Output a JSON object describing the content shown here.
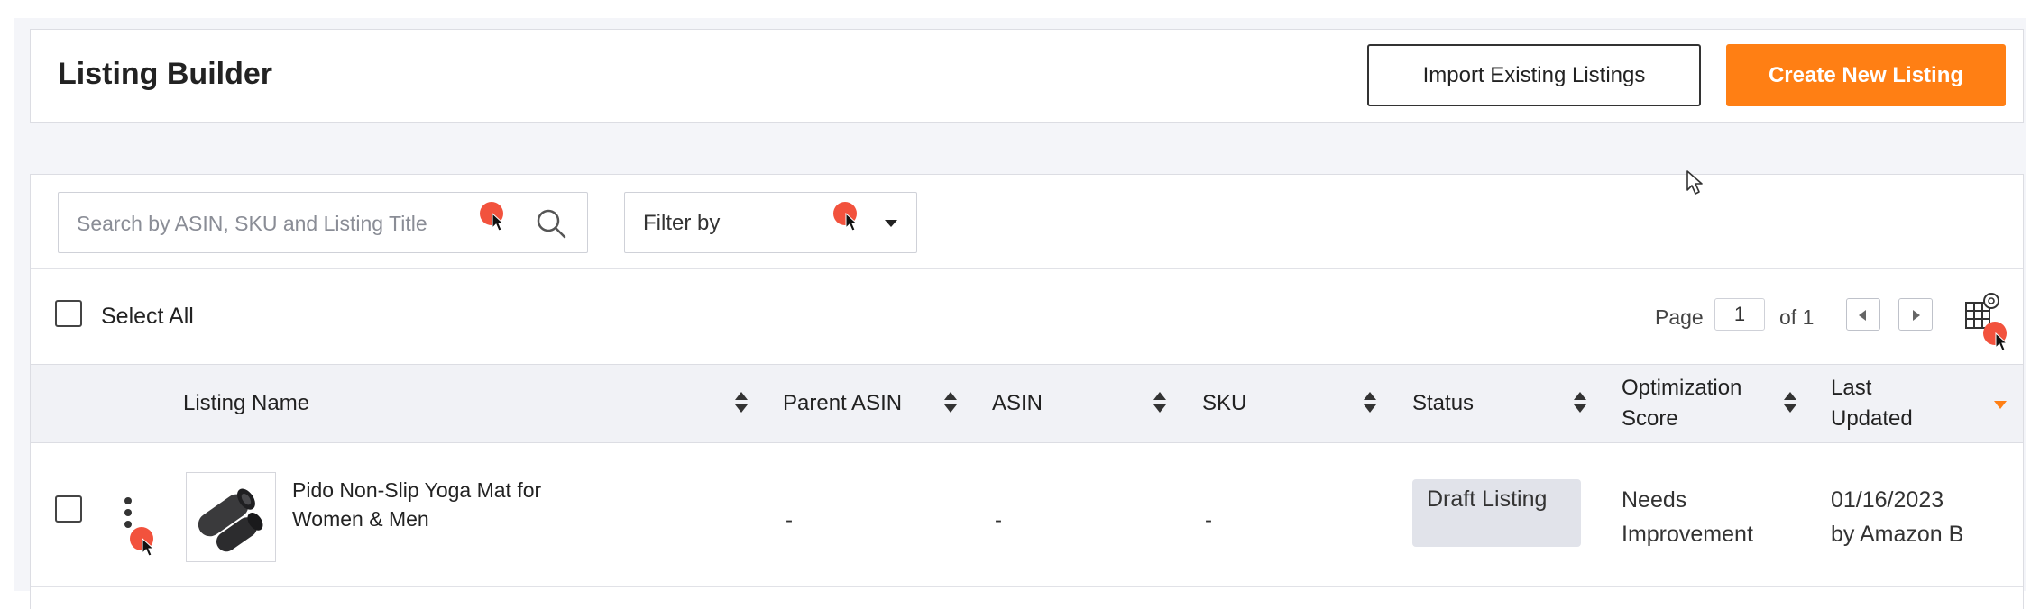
{
  "header": {
    "title": "Listing Builder",
    "import_label": "Import Existing Listings",
    "create_label": "Create New Listing"
  },
  "toolbar": {
    "search_placeholder": "Search by ASIN, SKU and Listing Title",
    "filter_label": "Filter by",
    "select_all_label": "Select All"
  },
  "pagination": {
    "page_label": "Page",
    "current_page": "1",
    "of_label": "of 1"
  },
  "table": {
    "columns": {
      "listing_name": "Listing Name",
      "parent_asin": "Parent ASIN",
      "asin": "ASIN",
      "sku": "SKU",
      "status": "Status",
      "optimization_score": "Optimization Score",
      "last_updated": "Last Updated"
    },
    "rows": [
      {
        "listing_name": "Pido Non-Slip Yoga Mat for Women & Men",
        "parent_asin": "-",
        "asin": "-",
        "sku": "-",
        "status": "Draft Listing",
        "optimization_score": "Needs Improvement",
        "last_updated_date": "01/16/2023",
        "last_updated_by": "by Amazon B"
      }
    ]
  },
  "colors": {
    "accent": "#ff7f14",
    "cursor_marker": "#f2523d",
    "header_bg": "#f1f2f6",
    "badge_bg": "#e1e3ea"
  },
  "icons": [
    "search-icon",
    "dropdown-caret-icon",
    "page-prev-icon",
    "page-next-icon",
    "column-settings-icon",
    "sort-icon",
    "kebab-menu-icon",
    "product-thumbnail"
  ]
}
